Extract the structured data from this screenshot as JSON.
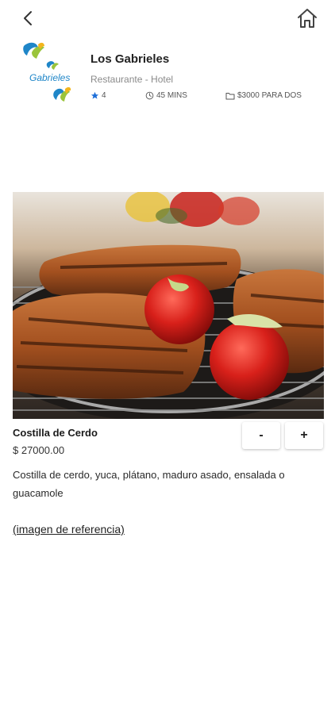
{
  "nav": {
    "back_icon": "chevron-left-icon",
    "home_icon": "home-icon"
  },
  "restaurant": {
    "name": "Los Gabrieles",
    "subtitle": "Restaurante - Hotel",
    "logo_text": "Gabrieles",
    "rating": "4",
    "time": "45 MINS",
    "price_for_two": "$3000 PARA DOS"
  },
  "dish": {
    "name": "Costilla de Cerdo",
    "price": "$ 27000.00",
    "description": "Costilla de cerdo, yuca, plátano, maduro asado, ensalada o guacamole",
    "reference_link": "(imagen de referencia)"
  },
  "quantity": {
    "minus_label": "-",
    "plus_label": "+"
  },
  "colors": {
    "star": "#1e6fd9",
    "logo_blue": "#1f86c8",
    "logo_green": "#9ac43b",
    "logo_yellow": "#f2b51d"
  }
}
